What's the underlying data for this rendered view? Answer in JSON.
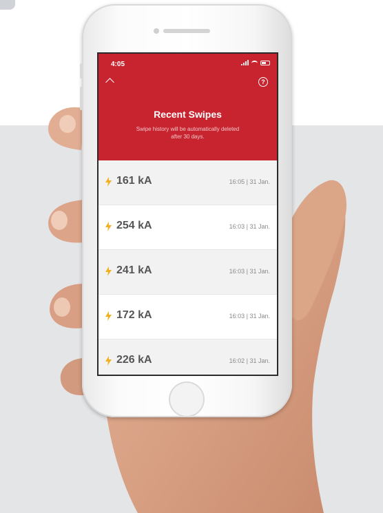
{
  "status_bar": {
    "time": "4:05"
  },
  "header": {
    "title": "Recent Swipes",
    "subtitle": "Swipe history will be automatically deleted after 30 days.",
    "back_icon": "chevron-up-icon",
    "help_icon": "help-circle-icon",
    "help_glyph": "?"
  },
  "swipes": [
    {
      "value": "161 kA",
      "timestamp": "16:05 | 31 Jan."
    },
    {
      "value": "254 kA",
      "timestamp": "16:03 | 31 Jan."
    },
    {
      "value": "241 kA",
      "timestamp": "16:03 | 31 Jan."
    },
    {
      "value": "172 kA",
      "timestamp": "16:03 | 31 Jan."
    },
    {
      "value": "226 kA",
      "timestamp": "16:02 | 31 Jan."
    }
  ],
  "colors": {
    "header_red": "#c8242f",
    "bolt_yellow": "#f2b01e",
    "row_alt": "#f2f2f2",
    "value_text": "#555555"
  }
}
